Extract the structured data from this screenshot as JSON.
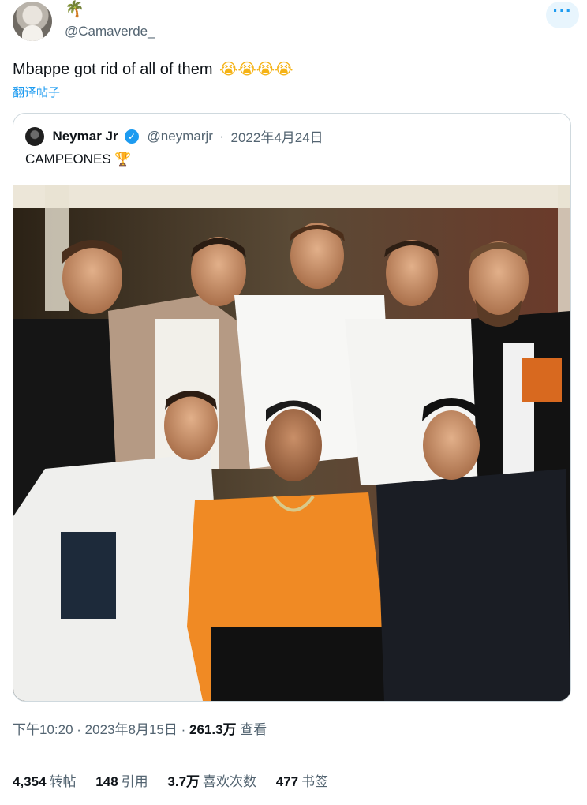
{
  "tweet": {
    "handle": "@Camaverde_",
    "header_emoji": "🌴",
    "text": "Mbappe got rid of all of them",
    "text_emoji": "😭😭😭😭",
    "translate_label": "翻译帖子",
    "more_label": "···"
  },
  "quote": {
    "name": "Neymar Jr",
    "handle": "@neymarjr",
    "date": "2022年4月24日",
    "text": "CAMPEONES",
    "text_emoji": "🏆",
    "verified_glyph": "✓"
  },
  "meta": {
    "time": "下午10:20",
    "date": "2023年8月15日",
    "views_count": "261.3万",
    "views_label": "查看"
  },
  "stats": [
    {
      "count": "4,354",
      "label": "转帖"
    },
    {
      "count": "148",
      "label": "引用"
    },
    {
      "count": "3.7万",
      "label": "喜欢次数"
    },
    {
      "count": "477",
      "label": "书签"
    }
  ],
  "colors": {
    "accent": "#1d9bf0",
    "secondary_text": "#536471",
    "border": "#cfd9de"
  }
}
